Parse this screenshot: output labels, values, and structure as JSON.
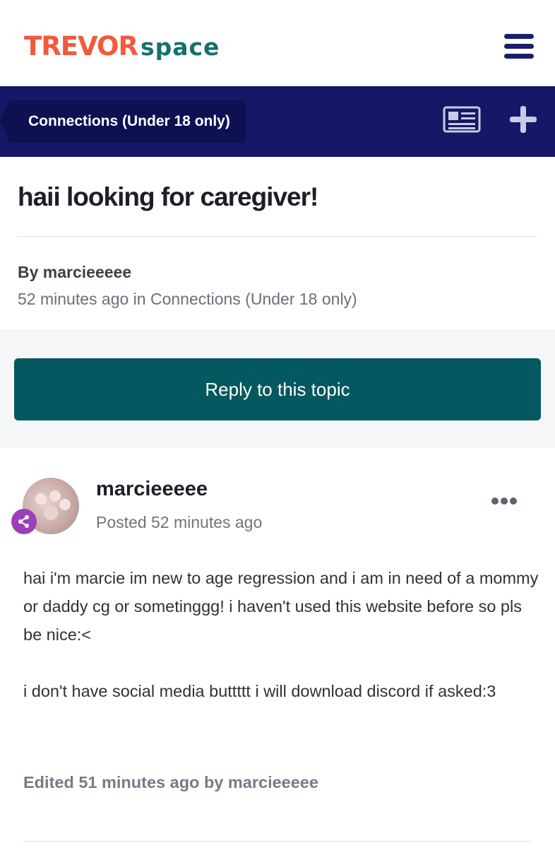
{
  "logo": {
    "part1": "TREVOR",
    "part2": "space"
  },
  "nav": {
    "breadcrumb": "Connections (Under 18 only)",
    "icons": [
      "newspaper-icon",
      "plus-icon",
      "hamburger-menu-icon"
    ]
  },
  "topic": {
    "title": "haii looking for caregiver!",
    "byline": "By marcieeeee",
    "meta": "52 minutes ago in Connections (Under 18 only)"
  },
  "reply_button": "Reply to this topic",
  "post": {
    "author": "marcieeeee",
    "posted": "Posted 52 minutes ago",
    "paragraphs": [
      "hai i'm marcie im new to age regression and i am in need of a mommy or daddy cg or sometinggg! i haven't used this website before so pls be nice:<",
      "i don't have social media buttttt i will download discord if asked:3"
    ],
    "edited": "Edited 51 minutes ago by marcieeeee"
  },
  "colors": {
    "logo_orange": "#f15a3c",
    "logo_teal": "#14706e",
    "navbar": "#161767",
    "reply_button": "#04585f",
    "badge": "#9c3fb8"
  }
}
